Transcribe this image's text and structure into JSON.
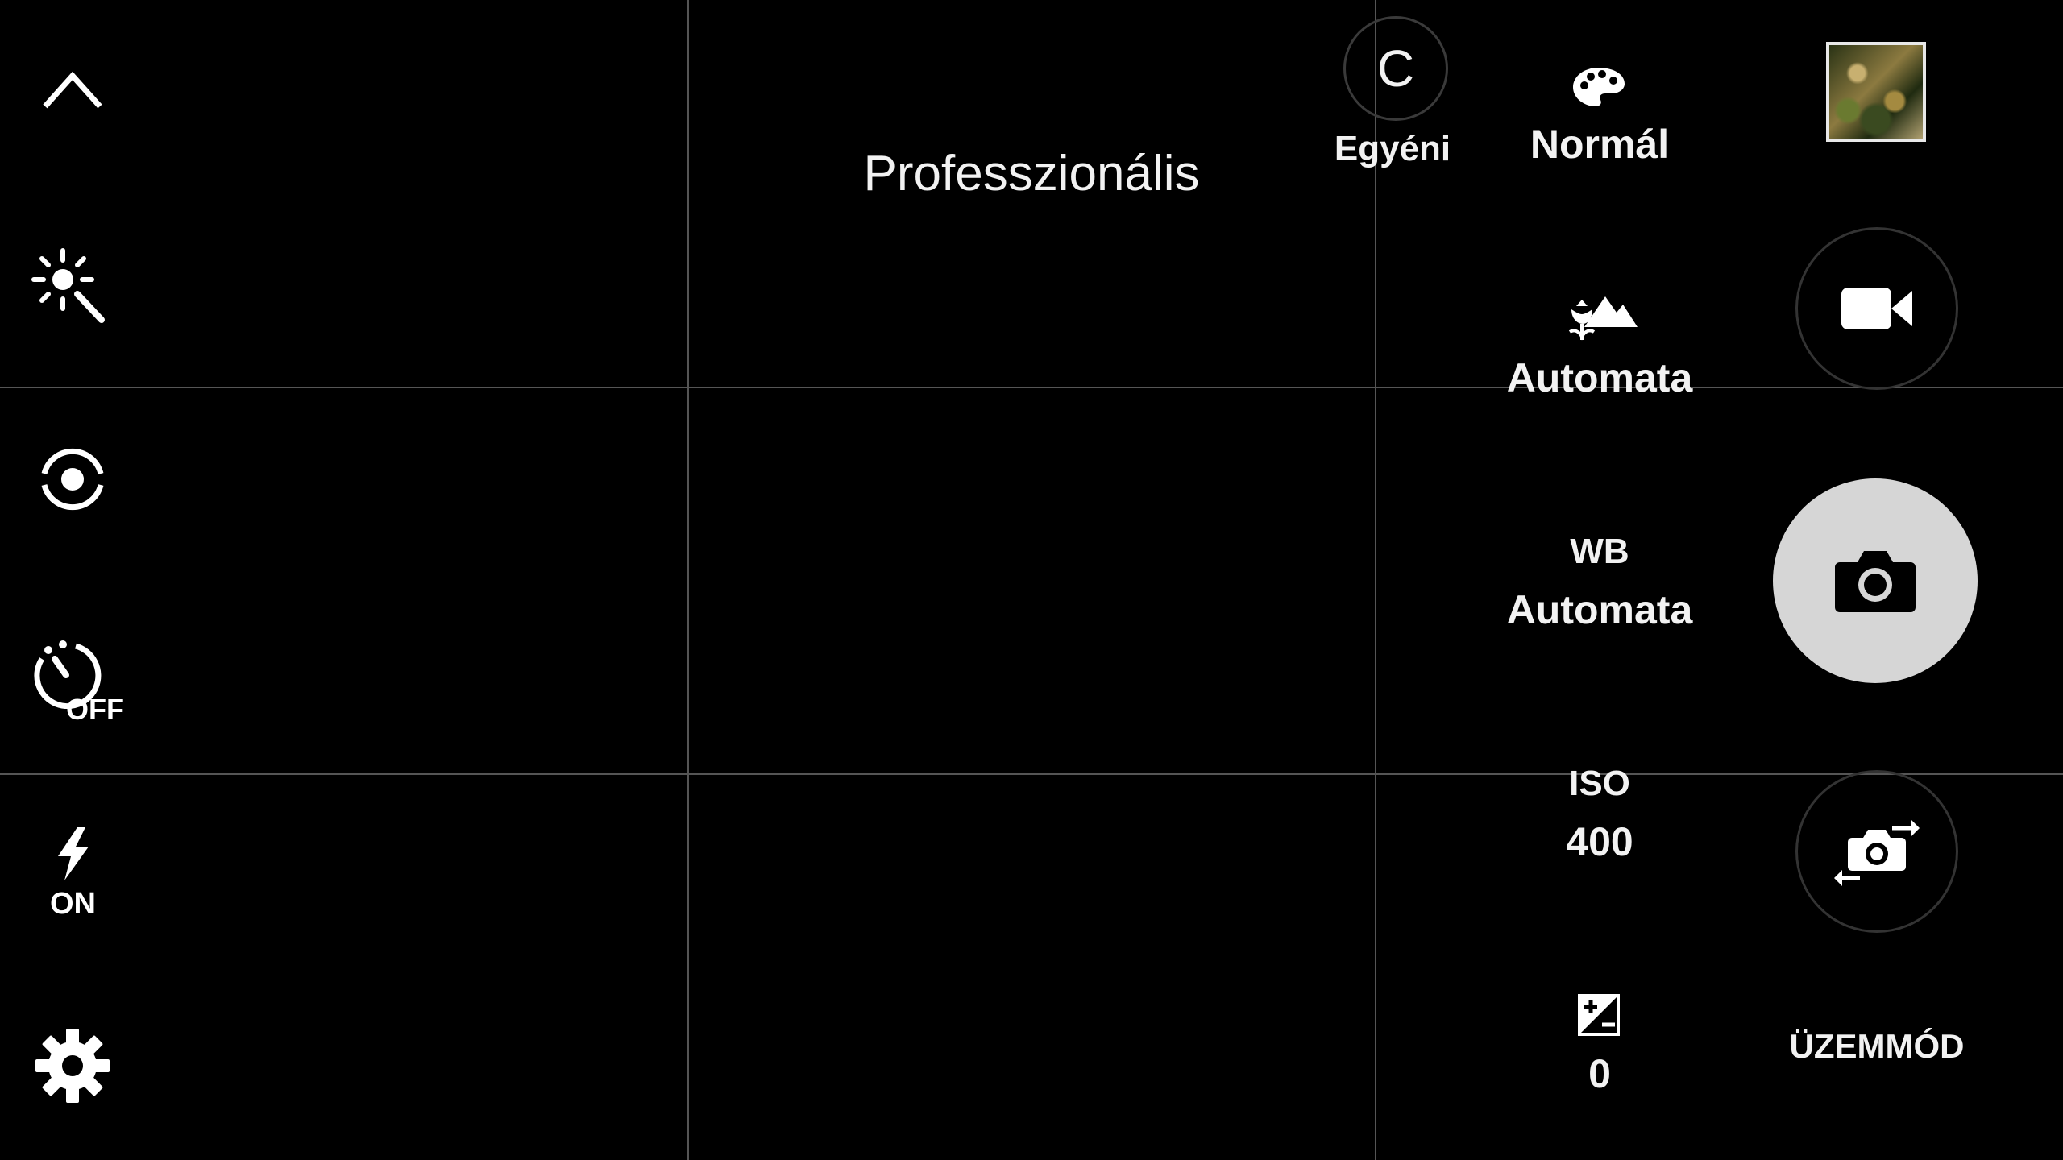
{
  "mode_title": "Professzionális",
  "left_toolbar": {
    "timer_label": "OFF",
    "flash_label": "ON"
  },
  "custom_mode": {
    "letter": "C",
    "label": "Egyéni"
  },
  "pro_controls": {
    "color_tone": "Normál",
    "focus": "Automata",
    "wb_title": "WB",
    "wb_value": "Automata",
    "iso_title": "ISO",
    "iso_value": "400",
    "exposure_value": "0"
  },
  "mode_button_label": "ÜZEMMÓD"
}
